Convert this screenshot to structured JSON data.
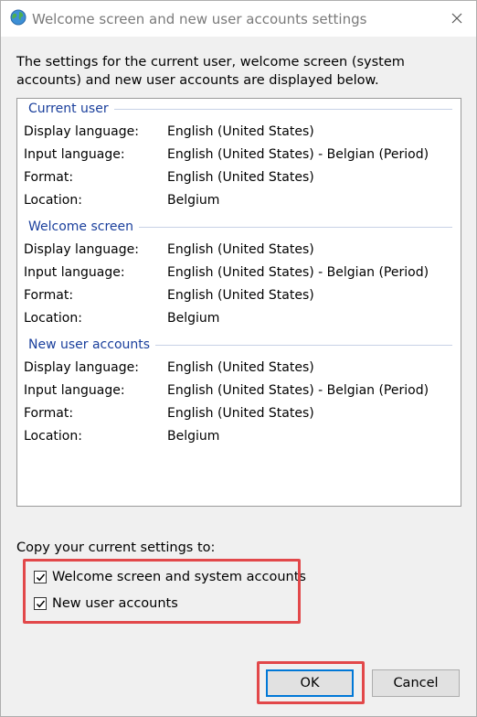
{
  "window": {
    "title": "Welcome screen and new user accounts settings",
    "close_label": "×"
  },
  "intro": "The settings for the current user, welcome screen (system accounts) and new user accounts are displayed below.",
  "sections": [
    {
      "title": "Current user",
      "rows": [
        {
          "label": "Display language:",
          "value": "English (United States)"
        },
        {
          "label": "Input language:",
          "value": "English (United States) - Belgian (Period)"
        },
        {
          "label": "Format:",
          "value": "English (United States)"
        },
        {
          "label": "Location:",
          "value": "Belgium"
        }
      ]
    },
    {
      "title": "Welcome screen",
      "rows": [
        {
          "label": "Display language:",
          "value": "English (United States)"
        },
        {
          "label": "Input language:",
          "value": "English (United States) - Belgian (Period)"
        },
        {
          "label": "Format:",
          "value": "English (United States)"
        },
        {
          "label": "Location:",
          "value": "Belgium"
        }
      ]
    },
    {
      "title": "New user accounts",
      "rows": [
        {
          "label": "Display language:",
          "value": "English (United States)"
        },
        {
          "label": "Input language:",
          "value": "English (United States) - Belgian (Period)"
        },
        {
          "label": "Format:",
          "value": "English (United States)"
        },
        {
          "label": "Location:",
          "value": "Belgium"
        }
      ]
    }
  ],
  "copy": {
    "label": "Copy your current settings to:",
    "options": [
      {
        "label": "Welcome screen and system accounts",
        "checked": true
      },
      {
        "label": "New user accounts",
        "checked": true
      }
    ]
  },
  "buttons": {
    "ok": "OK",
    "cancel": "Cancel"
  },
  "colors": {
    "section_title": "#1a3f9c",
    "highlight": "#e2484a",
    "default_button_border": "#0078d7"
  }
}
